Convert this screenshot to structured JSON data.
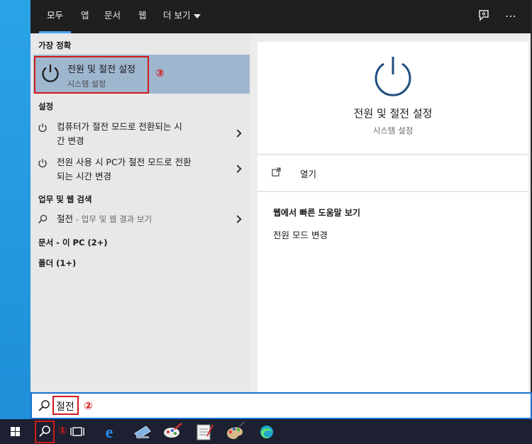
{
  "tabs": [
    {
      "label": "모두",
      "active": true
    },
    {
      "label": "앱",
      "active": false
    },
    {
      "label": "문서",
      "active": false
    },
    {
      "label": "웹",
      "active": false
    },
    {
      "label": "더 보기",
      "active": false
    }
  ],
  "left": {
    "best_match_header": "가장 정확",
    "best_match": {
      "title": "전원 및 절전 설정",
      "subtitle": "시스템 설정"
    },
    "settings_header": "설정",
    "settings_items": [
      {
        "line1": "컴퓨터가 절전 모드로 전환되는 시",
        "line2": "간 변경"
      },
      {
        "line1": "전원 사용 시 PC가 절전 모드로 전환",
        "line2": "되는 시간 변경"
      }
    ],
    "web_header": "업무 및 웹 검색",
    "web_item": {
      "query": "절전",
      "suffix": "- 업무 및 웹 결과 보기"
    },
    "docs_header": "문서 - 이 PC (2+)",
    "folders_header": "폴더 (1+)"
  },
  "right": {
    "title": "전원 및 절전 설정",
    "subtitle": "시스템 설정",
    "open_label": "열기",
    "web_help_header": "웹에서 빠른 도움말 보기",
    "web_help_link": "전원 모드 변경"
  },
  "search": {
    "value": "절전"
  },
  "annotations": {
    "one": "①",
    "two": "②",
    "three": "③"
  },
  "colors": {
    "accent": "#1b6fd0",
    "annotation": "#d01a1a",
    "selection": "#9fb6cf"
  }
}
